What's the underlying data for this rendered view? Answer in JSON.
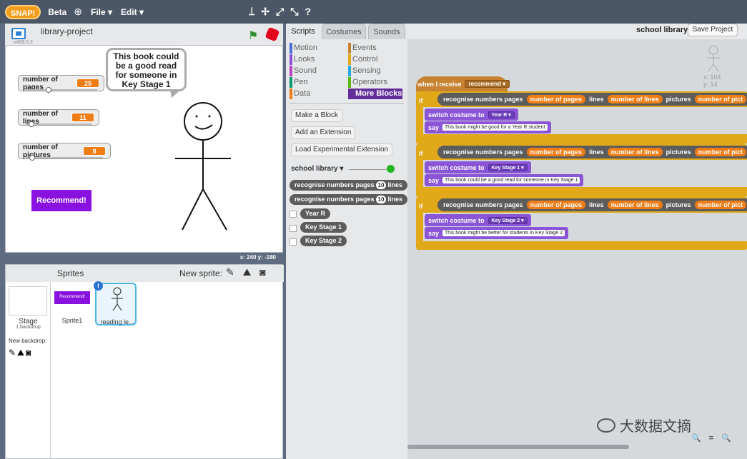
{
  "topbar": {
    "logo": "SNAP!",
    "beta": "Beta",
    "file": "File ▾",
    "edit": "Edit ▾",
    "tools": [
      "⟘",
      "✢",
      "⤢",
      "⤡",
      "?"
    ]
  },
  "stage": {
    "project_name": "library-project",
    "version": "v456.0.2",
    "monitors": [
      {
        "label": "number of pages",
        "value": "25",
        "slider_fraction": 0.3
      },
      {
        "label": "number of lines",
        "value": "11",
        "slider_fraction": 0.05
      },
      {
        "label": "number of pictures",
        "value": "8",
        "slider_fraction": 0.05
      }
    ],
    "speech": "This book could be a good read for someone in Key Stage 1",
    "button": "Recommend!",
    "coords": "x: 240   y: -180"
  },
  "sprites": {
    "label": "Sprites",
    "new_sprite": "New sprite:",
    "new_sprite_tools": "✎ ⛰ ◙",
    "stage_name": "Stage",
    "stage_sub": "1 backdrop",
    "new_backdrop": "New backdrop:",
    "backdrop_tools": "✎⛰◙",
    "tiles": [
      {
        "name": "Sprite1",
        "thumb_text": "Recommend!"
      },
      {
        "name": "reading le...",
        "info": "i"
      }
    ]
  },
  "palette": {
    "tabs": [
      "Scripts",
      "Costumes",
      "Sounds"
    ],
    "categories": [
      {
        "label": "Motion",
        "color": "#4a6cd4"
      },
      {
        "label": "Looks",
        "color": "#8a55d7"
      },
      {
        "label": "Sound",
        "color": "#bb42c3"
      },
      {
        "label": "Pen",
        "color": "#0e9a6c"
      },
      {
        "label": "Data",
        "color": "#ee7d16"
      },
      {
        "label": "Events",
        "color": "#c88330"
      },
      {
        "label": "Control",
        "color": "#e1a91a"
      },
      {
        "label": "Sensing",
        "color": "#2ca5e2"
      },
      {
        "label": "Operators",
        "color": "#5cb712"
      },
      {
        "label": "More Blocks",
        "color": "#632d99"
      }
    ],
    "buttons": [
      "Make a Block",
      "Add an Extension",
      "Load Experimental Extension"
    ],
    "library": "school library ▾",
    "reporter1": "recognise numbers pages",
    "reporter1_num": "10",
    "reporter1_tail": "lines",
    "reporter2": "recognise numbers pages",
    "reporter2_num": "10",
    "reporter2_tail": "lines",
    "reporters": [
      "Year R",
      "Key Stage 1",
      "Key Stage 2"
    ]
  },
  "script": {
    "sprite_name": "school library",
    "save": "Save Project",
    "corner_x": "x: 104",
    "corner_y": "y: 14",
    "hat": "when I receive",
    "hat_msg": "recommend ▾",
    "if_label": "if",
    "rec": "recognise numbers pages",
    "v_pages": "number of pages",
    "lines": "lines",
    "v_lines": "number of lines",
    "pictures": "pictures",
    "v_pictures": "number of pict",
    "switch": "switch costume to",
    "say": "say",
    "branches": [
      {
        "costume": "Year R ▾",
        "say": "This book might be good for a Year R student"
      },
      {
        "costume": "Key Stage 1 ▾",
        "say": "This book could be a good read for someone in Key Stage 1"
      },
      {
        "costume": "Key Stage 2 ▾",
        "say": "This book might be better for students in Key Stage 2"
      }
    ],
    "zoom": "🔍 = 🔍",
    "watermark": "大数据文摘"
  }
}
